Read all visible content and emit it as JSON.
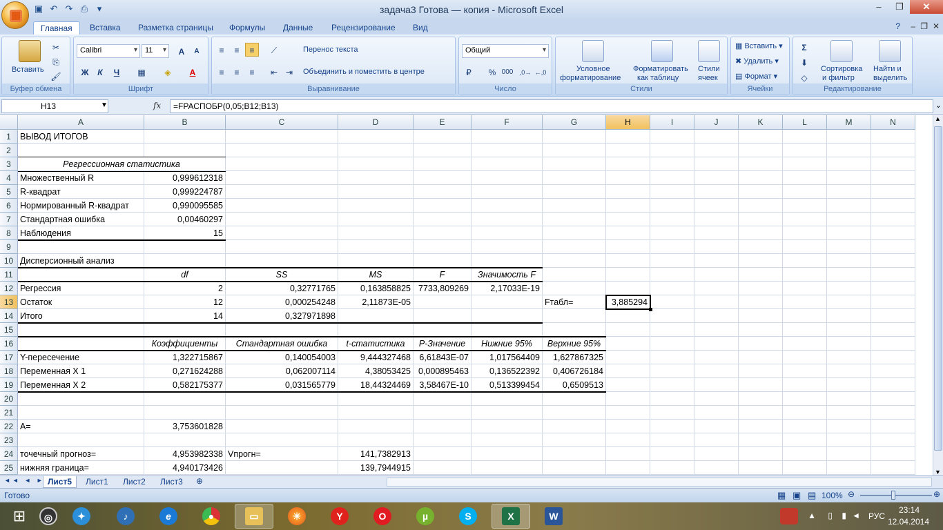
{
  "window": {
    "title": "задача3 Готова — копия - Microsoft Excel"
  },
  "ribbon_tabs": [
    "Главная",
    "Вставка",
    "Разметка страницы",
    "Формулы",
    "Данные",
    "Рецензирование",
    "Вид"
  ],
  "ribbon": {
    "clipboard": {
      "paste": "Вставить",
      "group": "Буфер обмена"
    },
    "font": {
      "name": "Calibri",
      "size": "11",
      "bold": "Ж",
      "italic": "К",
      "underline": "Ч",
      "group": "Шрифт"
    },
    "alignment": {
      "wrap": "Перенос текста",
      "merge": "Объединить и поместить в центре",
      "group": "Выравнивание"
    },
    "number": {
      "format": "Общий",
      "percent": "%",
      "thousands": "000",
      "group": "Число"
    },
    "styles": {
      "conditional": "Условное",
      "conditional2": "форматирование",
      "format_table": "Форматировать",
      "format_table2": "как таблицу",
      "cell_styles": "Стили",
      "cell_styles2": "ячеек",
      "group": "Стили"
    },
    "cells": {
      "insert": "Вставить",
      "delete": "Удалить",
      "format": "Формат",
      "group": "Ячейки"
    },
    "editing": {
      "sort": "Сортировка",
      "sort2": "и фильтр",
      "find": "Найти и",
      "find2": "выделить",
      "group": "Редактирование"
    }
  },
  "formula_bar": {
    "name_box": "H13",
    "fx": "fx",
    "formula": "=FРАСПОБР(0,05;B12;B13)"
  },
  "columns": [
    "A",
    "B",
    "C",
    "D",
    "E",
    "F",
    "G",
    "H",
    "I",
    "J",
    "K",
    "L",
    "M",
    "N"
  ],
  "rows": [
    "1",
    "2",
    "3",
    "4",
    "5",
    "6",
    "7",
    "8",
    "9",
    "10",
    "11",
    "12",
    "13",
    "14",
    "15",
    "16",
    "17",
    "18",
    "19",
    "20",
    "21",
    "22",
    "23",
    "24",
    "25"
  ],
  "cells": {
    "A1": "ВЫВОД ИТОГОВ",
    "A3": "Регрессионная статистика",
    "A4": "Множественный R",
    "B4": "0,999612318",
    "A5": "R-квадрат",
    "B5": "0,999224787",
    "A6": "Нормированный R-квадрат",
    "B6": "0,990095585",
    "A7": "Стандартная ошибка",
    "B7": "0,00460297",
    "A8": "Наблюдения",
    "B8": "15",
    "A10": "Дисперсионный анализ",
    "B11": "df",
    "C11": "SS",
    "D11": "MS",
    "E11": "F",
    "F11": "Значимость F",
    "A12": "Регрессия",
    "B12": "2",
    "C12": "0,32771765",
    "D12": "0,163858825",
    "E12": "7733,809269",
    "F12": "2,17033E-19",
    "A13": "Остаток",
    "B13": "12",
    "C13": "0,000254248",
    "D13": "2,11873E-05",
    "G13": "Fтабл=",
    "H13": "3,885294",
    "A14": "Итого",
    "B14": "14",
    "C14": "0,327971898",
    "B16": "Коэффициенты",
    "C16": "Стандартная ошибка",
    "D16": "t-статистика",
    "E16": "P-Значение",
    "F16": "Нижние 95%",
    "G16": "Верхние 95%",
    "A17": "Y-пересечение",
    "B17": "1,322715867",
    "C17": "0,140054003",
    "D17": "9,444327468",
    "E17": "6,61843E-07",
    "F17": "1,017564409",
    "G17": "1,627867325",
    "A18": "Переменная X 1",
    "B18": "0,271624288",
    "C18": "0,062007114",
    "D18": "4,38053425",
    "E18": "0,000895463",
    "F18": "0,136522392",
    "G18": "0,406726184",
    "A19": "Переменная X 2",
    "B19": "0,582175377",
    "C19": "0,031565779",
    "D19": "18,44324469",
    "E19": "3,58467E-10",
    "F19": "0,513399454",
    "G19": "0,6509513",
    "A22": "A=",
    "B22": "3,753601828",
    "A24": "точечный прогноз=",
    "B24": "4,953982338",
    "C24": "Vпрогн=",
    "D24": "141,7382913",
    "A25": "нижняя граница=",
    "B25": "4,940173426",
    "D25": "139,7944915"
  },
  "sheets": [
    "Лист5",
    "Лист1",
    "Лист2",
    "Лист3"
  ],
  "status": {
    "ready": "Готово",
    "zoom": "100%"
  },
  "taskbar": {
    "lang": "РУС",
    "time": "23:14",
    "date": "12.04.2014"
  },
  "colors": {
    "accent": "#15428b",
    "ribbon_bg": "#dbe7f6",
    "selected_header": "#f1c15f"
  }
}
